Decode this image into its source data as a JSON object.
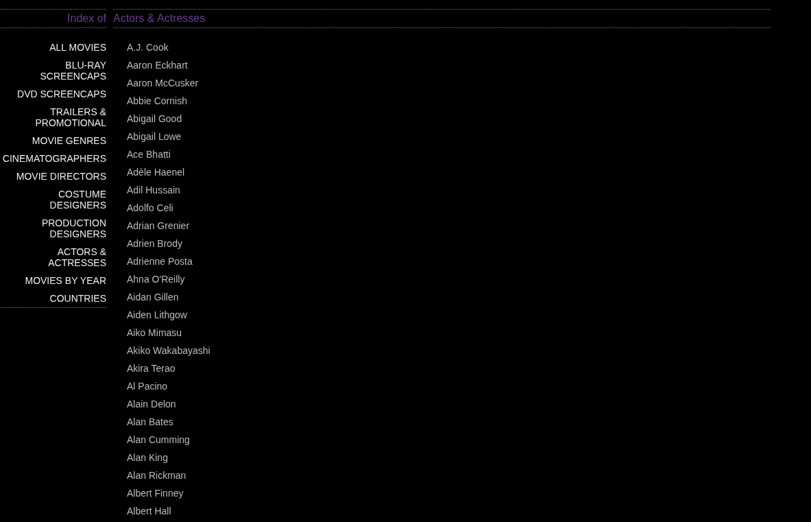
{
  "header": {
    "prefix": "Index of",
    "title": "Actors & Actresses"
  },
  "sidebar": {
    "items": [
      "ALL MOVIES",
      "BLU-RAY SCREENCAPS",
      "DVD SCREENCAPS",
      "TRAILERS & PROMOTIONAL",
      "MOVIE GENRES",
      "CINEMATOGRAPHERS",
      "MOVIE DIRECTORS",
      "COSTUME DESIGNERS",
      "PRODUCTION DESIGNERS",
      "ACTORS & ACTRESSES",
      "MOVIES BY YEAR",
      "COUNTRIES"
    ]
  },
  "names": [
    "A.J. Cook",
    "Aaron Eckhart",
    "Aaron McCusker",
    "Abbie Cornish",
    "Abigail Good",
    "Abigail Lowe",
    "Ace Bhatti",
    "Adèle Haenel",
    "Adil Hussain",
    "Adolfo Celi",
    "Adrian Grenier",
    "Adrien Brody",
    "Adrienne Posta",
    "Ahna O'Reilly",
    "Aidan Gillen",
    "Aiden Lithgow",
    "Aiko Mimasu",
    "Akiko Wakabayashi",
    "Akira Terao",
    "Al Pacino",
    "Alain Delon",
    "Alan Bates",
    "Alan Cumming",
    "Alan King",
    "Alan Rickman",
    "Albert Finney",
    "Albert Hall"
  ]
}
